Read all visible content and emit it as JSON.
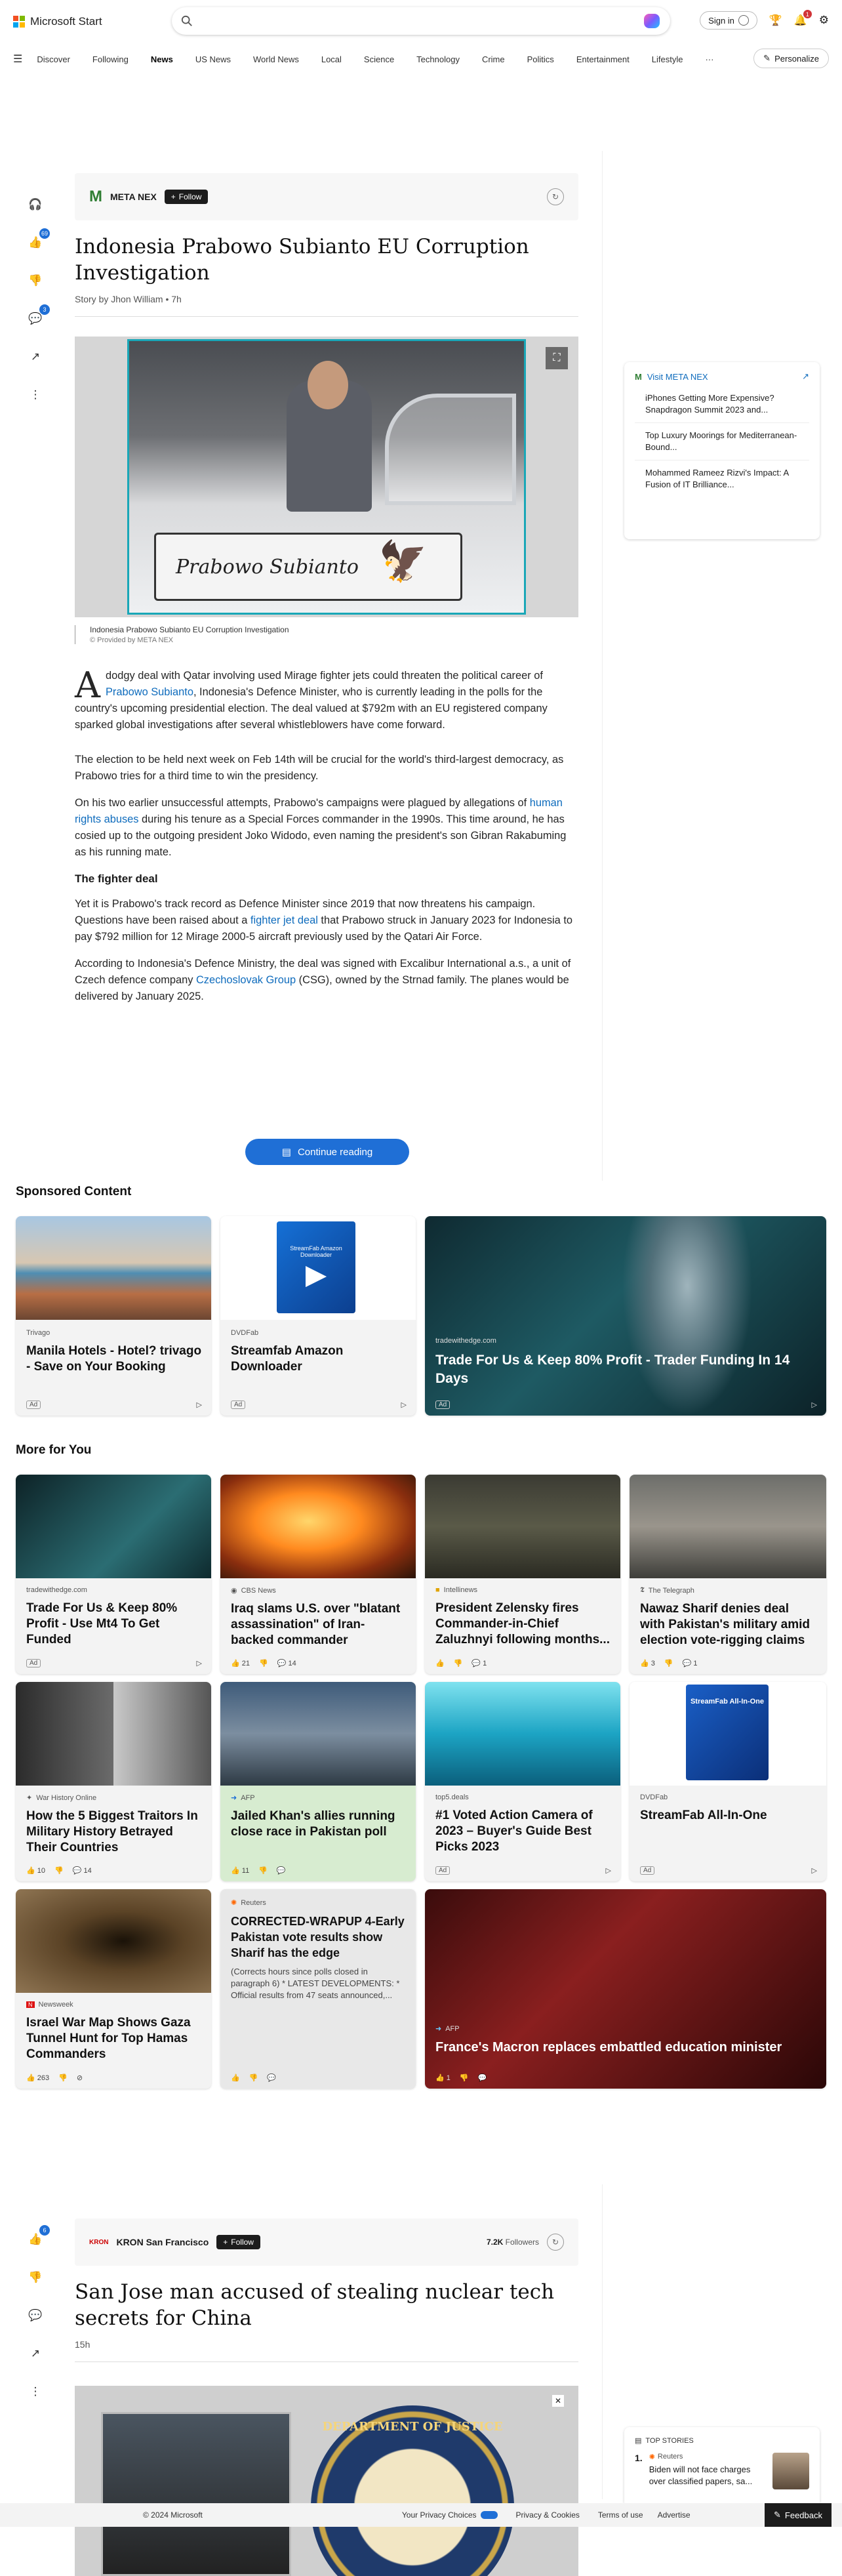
{
  "header": {
    "brand": "Microsoft Start",
    "signin": "Sign in",
    "notif_count": "1"
  },
  "nav": {
    "items": [
      "Discover",
      "Following",
      "News",
      "US News",
      "World News",
      "Local",
      "Science",
      "Technology",
      "Crime",
      "Politics",
      "Entertainment",
      "Lifestyle"
    ],
    "more": "···",
    "personalize": "Personalize"
  },
  "tools1": {
    "likes": "69",
    "comments": "3"
  },
  "article1": {
    "source": "META NEX",
    "follow": "Follow",
    "title": "Indonesia Prabowo Subianto EU Corruption Investigation",
    "byline": "Story by Jhon William • 7h",
    "plate_text": "Prabowo Subianto",
    "caption": "Indonesia Prabowo Subianto EU Corruption Investigation",
    "credit": "© Provided by META NEX",
    "dropcap": "A",
    "p1_a": "dodgy deal with Qatar involving used Mirage fighter jets could threaten the political career of ",
    "p1_link": "Prabowo Subianto",
    "p1_b": ", Indonesia's Defence Minister, who is currently leading in the polls for the country's upcoming presidential election. The deal valued at $792m with an EU registered company sparked global investigations after several whistleblowers have come forward.",
    "p2": "The election to be held next week on Feb 14th will be crucial for the world's third-largest democracy, as Prabowo tries for a third time to win the presidency.",
    "p3_a": "On his two earlier unsuccessful attempts, Prabowo's campaigns were plagued by allegations of ",
    "p3_link": "human rights abuses",
    "p3_b": " during his tenure as a Special Forces commander in the 1990s. This time around, he has cosied up to the outgoing president Joko Widodo, even naming the president's son Gibran Rakabuming as his running mate.",
    "h_fighter": "The fighter deal",
    "p4_a": "Yet it is Prabowo's track record as Defence Minister since 2019 that now threatens his campaign. Questions have been raised about a ",
    "p4_link": "fighter jet deal",
    "p4_b": " that Prabowo struck in January 2023 for Indonesia to pay $792 million for 12 Mirage 2000-5 aircraft previously used by the Qatari Air Force.",
    "p5_a": "According to Indonesia's Defence Ministry, the deal was signed with Excalibur International a.s., a unit of Czech defence company ",
    "p5_link": "Czechoslovak Group",
    "p5_b": " (CSG), owned by the Strnad family. The planes would be delivered by January 2025.",
    "continue": "Continue reading"
  },
  "rail": {
    "title": "Visit META NEX",
    "items": [
      "iPhones Getting More Expensive? Snapdragon Summit 2023 and...",
      "Top Luxury Moorings for Mediterranean-Bound...",
      "Mohammed Rameez Rizvi's Impact: A Fusion of IT Brilliance..."
    ]
  },
  "sponsored": {
    "heading": "Sponsored Content",
    "cards": [
      {
        "source": "Trivago",
        "title": "Manila Hotels - Hotel? trivago - Save on Your Booking",
        "ad": "Ad"
      },
      {
        "source": "DVDFab",
        "title": "Streamfab Amazon Downloader",
        "ad": "Ad",
        "box_text": "StreamFab Amazon Downloader"
      },
      {
        "source": "tradewithedge.com",
        "title": "Trade For Us & Keep 80% Profit - Trader Funding In 14 Days",
        "ad": "Ad"
      }
    ]
  },
  "more": {
    "heading": "More for You",
    "row1": [
      {
        "source": "tradewithedge.com",
        "title": "Trade For Us & Keep 80% Profit - Use Mt4 To Get Funded",
        "ad": "Ad"
      },
      {
        "source": "CBS News",
        "title": "Iraq slams U.S. over \"blatant assassination\" of Iran-backed commander",
        "likes": "21",
        "comments": "14"
      },
      {
        "source": "Intellinews",
        "title": "President Zelensky fires Commander-in-Chief Zaluzhnyi following months...",
        "likes": "",
        "comments": "1"
      },
      {
        "source": "The Telegraph",
        "title": "Nawaz Sharif denies deal with Pakistan's military amid election vote-rigging claims",
        "likes": "3",
        "comments": "1"
      }
    ],
    "row2": [
      {
        "source": "War History Online",
        "title": "How the 5 Biggest Traitors In Military History Betrayed Their Countries",
        "likes": "10",
        "comments": "14"
      },
      {
        "source": "AFP",
        "title": "Jailed Khan's allies running close race in Pakistan poll",
        "likes": "11",
        "comments": ""
      },
      {
        "source": "top5.deals",
        "title": "#1 Voted Action Camera of 2023 – Buyer's Guide Best Picks 2023",
        "ad": "Ad"
      },
      {
        "source": "DVDFab",
        "title": "StreamFab All-In-One",
        "ad": "Ad",
        "box_text": "StreamFab All-In-One"
      }
    ],
    "row3": [
      {
        "source": "Newsweek",
        "title": "Israel War Map Shows Gaza Tunnel Hunt for Top Hamas Commanders",
        "likes": "263",
        "comments": ""
      },
      {
        "source": "Reuters",
        "title": "CORRECTED-WRAPUP 4-Early Pakistan vote results show Sharif has the edge",
        "snippet": "(Corrects hours since polls closed in paragraph 6) * LATEST DEVELOPMENTS: * Official results from 47 seats announced,...",
        "likes": "",
        "comments": ""
      },
      {
        "source": "AFP",
        "title": "France's Macron replaces embattled education minister",
        "likes": "1",
        "comments": ""
      }
    ]
  },
  "tools2": {
    "likes": "6"
  },
  "article2": {
    "source": "KRON San Francisco",
    "follow": "Follow",
    "followers_count": "7.2K",
    "followers_label": "Followers",
    "title": "San Jose man accused of stealing nuclear tech secrets for China",
    "time": "15h",
    "seal_text": "DEPARTMENT OF JUSTICE"
  },
  "topstories": {
    "heading": "TOP STORIES",
    "num": "1.",
    "source": "Reuters",
    "title": "Biden will not face charges over classified papers, sa..."
  },
  "footer": {
    "copyright": "© 2024 Microsoft",
    "privacy": "Your Privacy Choices",
    "cookies": "Privacy & Cookies",
    "terms": "Terms of use",
    "advertise": "Advertise",
    "feedback": "Feedback"
  }
}
